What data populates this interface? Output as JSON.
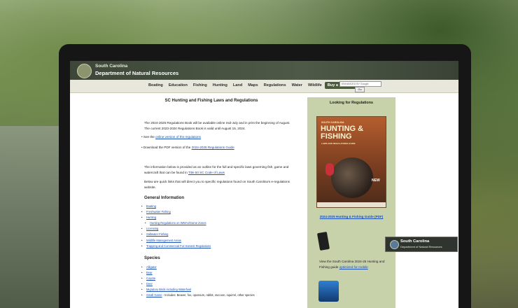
{
  "site": {
    "org_line1": "South Carolina",
    "org_line2": "Department of Natural Resources"
  },
  "nav": {
    "items": [
      "Boating",
      "Education",
      "Fishing",
      "Hunting",
      "Land",
      "Maps",
      "Regulations",
      "Water",
      "Wildlife"
    ],
    "license_button": "Buy a license",
    "search_placeholder": "ENHANCED BY Google",
    "go_label": "Go"
  },
  "main": {
    "title": "SC Hunting and Fishing Laws and Regulations",
    "intro": "The 2024-2025 Regulations Book will be available online mid-July and in print the beginning of August. The current 2023-2024 Regulations Book is valid until August 15, 2024.",
    "see_prefix": "See the",
    "see_link": "online version of the regulations",
    "pdf_prefix": "Download the PDF version of the",
    "pdf_link": "2024-2025 Regulations Guide",
    "outline_text": "The information below is provided as an outline for the full and specific laws governing fish, game and watercraft that can be found in",
    "outline_link": "Title 50 SC Code of Laws",
    "quicklinks_text": "Below are quick links that will direct you to specific regulations found on South Carolina's e-regulations website.",
    "general_heading": "General Information",
    "general_items": [
      "Boating",
      "Freshwater Fishing",
      "Hunting",
      "Hunting Regulations on WMAs/Game Zones",
      "Licensing",
      "Saltwater Fishing",
      "Wildlife Management Areas",
      "Trapping and Commercial Fur Harvest Regulations"
    ],
    "species_heading": "Species",
    "species_items": [
      "Alligator",
      "Bear",
      "Coyote",
      "Deer",
      "Migratory Birds including Waterfowl",
      "Small Game"
    ],
    "small_game_tail": " - Includes: Beaver, fox, opossum, rabbit, raccoon, squirrel, other species"
  },
  "sidebar": {
    "title": "Looking for Regulations",
    "cover_small": "SOUTH CAROLINA",
    "cover_title": "HUNTING & FISHING",
    "cover_sub": "LAWS AND REGULATIONS GUIDE",
    "cover_badge": "NEW",
    "guide_link": "2024-2025 Hunting & Fishing Guide (PDF)",
    "mobile_text_prefix": "View the South Carolina 2024-25 Hunting and Fishing guide",
    "mobile_link": "optimized for mobile"
  },
  "overlay_badge": {
    "line1": "South Carolina",
    "line2": "Department of Natural Resources"
  }
}
